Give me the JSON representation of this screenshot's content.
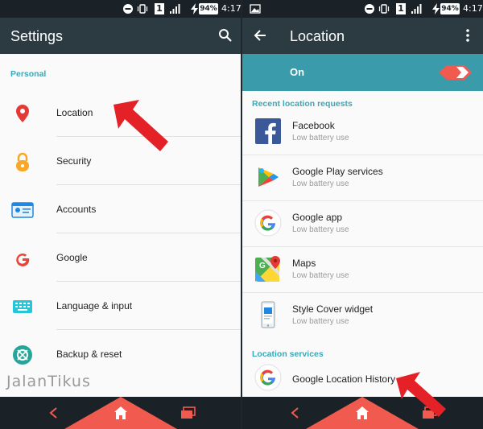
{
  "status_bar": {
    "sim_slot": "1",
    "battery": "94%",
    "time": "4:17"
  },
  "left_screen": {
    "title": "Settings",
    "section": "Personal",
    "items": [
      {
        "label": "Location",
        "icon": "location-pin-icon"
      },
      {
        "label": "Security",
        "icon": "lock-icon"
      },
      {
        "label": "Accounts",
        "icon": "account-card-icon"
      },
      {
        "label": "Google",
        "icon": "google-g-icon"
      },
      {
        "label": "Language & input",
        "icon": "keyboard-icon"
      },
      {
        "label": "Backup & reset",
        "icon": "backup-icon"
      }
    ]
  },
  "right_screen": {
    "title": "Location",
    "toggle_label": "On",
    "toggle_state": "on",
    "recent_section": "Recent location requests",
    "apps": [
      {
        "name": "Facebook",
        "usage": "Low battery use",
        "icon": "facebook-icon"
      },
      {
        "name": "Google Play services",
        "usage": "Low battery use",
        "icon": "play-services-icon"
      },
      {
        "name": "Google app",
        "usage": "Low battery use",
        "icon": "google-g-icon"
      },
      {
        "name": "Maps",
        "usage": "Low battery use",
        "icon": "maps-icon"
      },
      {
        "name": "Style Cover widget",
        "usage": "Low battery use",
        "icon": "phone-widget-icon"
      }
    ],
    "services_section": "Location services",
    "services": [
      {
        "name": "Google Location History",
        "icon": "google-g-icon"
      }
    ]
  },
  "watermark": "JalanTikus",
  "colors": {
    "app_bar": "#2c3a41",
    "status_bar": "#1a2227",
    "toggle_bar": "#3a9caa",
    "accent": "#3aa8b6",
    "nav_highlight": "#f05a4f",
    "annotation_arrow": "#e42126"
  }
}
